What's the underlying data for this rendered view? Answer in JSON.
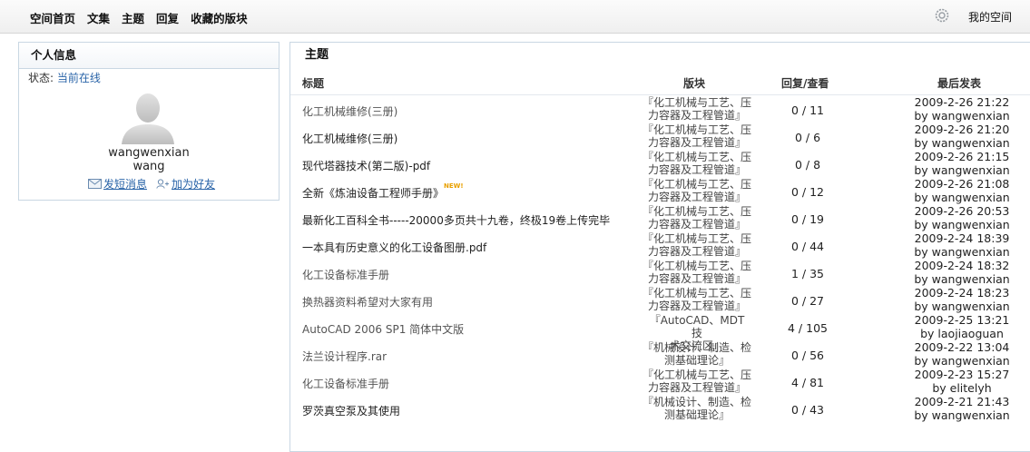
{
  "nav": {
    "items": [
      "空间首页",
      "文集",
      "主题",
      "回复",
      "收藏的版块"
    ],
    "my_space": "我的空间"
  },
  "profile": {
    "panel_title": "个人信息",
    "status_label": "状态:",
    "status_value": "当前在线",
    "username": "wangwenxian",
    "display_name": "wang",
    "send_message": "发短消息",
    "add_friend": "加为好友"
  },
  "topics": {
    "panel_title": "主题",
    "headers": {
      "title": "标题",
      "board": "版块",
      "counts": "回复/查看",
      "last": "最后发表"
    },
    "rows": [
      {
        "title": "化工机械维修(三册)",
        "board_l1": "『化工机械与工艺、压",
        "board_l2": "力容器及工程管道』",
        "counts": "0 / 11",
        "last_time": "2009-2-26 21:22",
        "last_by": "by wangwenxian",
        "new": false,
        "grey": true
      },
      {
        "title": "化工机械维修(三册)",
        "board_l1": "『化工机械与工艺、压",
        "board_l2": "力容器及工程管道』",
        "counts": "0 / 6",
        "last_time": "2009-2-26 21:20",
        "last_by": "by wangwenxian",
        "new": false,
        "grey": false
      },
      {
        "title": "现代塔器技术(第二版)-pdf",
        "board_l1": "『化工机械与工艺、压",
        "board_l2": "力容器及工程管道』",
        "counts": "0 / 8",
        "last_time": "2009-2-26 21:15",
        "last_by": "by wangwenxian",
        "new": false,
        "grey": false
      },
      {
        "title": "全新《炼油设备工程师手册》",
        "board_l1": "『化工机械与工艺、压",
        "board_l2": "力容器及工程管道』",
        "counts": "0 / 12",
        "last_time": "2009-2-26 21:08",
        "last_by": "by wangwenxian",
        "new": true,
        "grey": false
      },
      {
        "title": "最新化工百科全书-----20000多页共十九卷，终极19卷上传完毕",
        "board_l1": "『化工机械与工艺、压",
        "board_l2": "力容器及工程管道』",
        "counts": "0 / 19",
        "last_time": "2009-2-26 20:53",
        "last_by": "by wangwenxian",
        "new": false,
        "grey": false
      },
      {
        "title": "一本具有历史意义的化工设备图册.pdf",
        "board_l1": "『化工机械与工艺、压",
        "board_l2": "力容器及工程管道』",
        "counts": "0 / 44",
        "last_time": "2009-2-24 18:39",
        "last_by": "by wangwenxian",
        "new": false,
        "grey": false
      },
      {
        "title": "化工设备标准手册",
        "board_l1": "『化工机械与工艺、压",
        "board_l2": "力容器及工程管道』",
        "counts": "1 / 35",
        "last_time": "2009-2-24 18:32",
        "last_by": "by wangwenxian",
        "new": false,
        "grey": true
      },
      {
        "title": "换热器资料希望对大家有用",
        "board_l1": "『化工机械与工艺、压",
        "board_l2": "力容器及工程管道』",
        "counts": "0 / 27",
        "last_time": "2009-2-24 18:23",
        "last_by": "by wangwenxian",
        "new": false,
        "grey": true
      },
      {
        "title": "AutoCAD 2006 SP1 简体中文版",
        "board_l1": "『AutoCAD、MDT 技",
        "board_l2": "术交流区』",
        "counts": "4 / 105",
        "last_time": "2009-2-25 13:21",
        "last_by": "by laojiaoguan",
        "new": false,
        "grey": true
      },
      {
        "title": "法兰设计程序.rar",
        "board_l1": "『机械设计、制造、检",
        "board_l2": "测基础理论』",
        "counts": "0 / 56",
        "last_time": "2009-2-22 13:04",
        "last_by": "by wangwenxian",
        "new": false,
        "grey": true
      },
      {
        "title": "化工设备标准手册",
        "board_l1": "『化工机械与工艺、压",
        "board_l2": "力容器及工程管道』",
        "counts": "4 / 81",
        "last_time": "2009-2-23 15:27",
        "last_by": "by elitelyh",
        "new": false,
        "grey": true
      },
      {
        "title": "罗茨真空泵及其使用",
        "board_l1": "『机械设计、制造、检",
        "board_l2": "测基础理论』",
        "counts": "0 / 43",
        "last_time": "2009-2-21 21:43",
        "last_by": "by wangwenxian",
        "new": false,
        "grey": false
      }
    ]
  },
  "colors": {
    "link": "#2a64a8",
    "border": "#c9d7e3",
    "new_badge": "#e8a000"
  },
  "icons": [
    "gear-icon",
    "avatar-silhouette",
    "envelope-icon",
    "add-friend-icon"
  ],
  "new_badge_text": "NEW!"
}
